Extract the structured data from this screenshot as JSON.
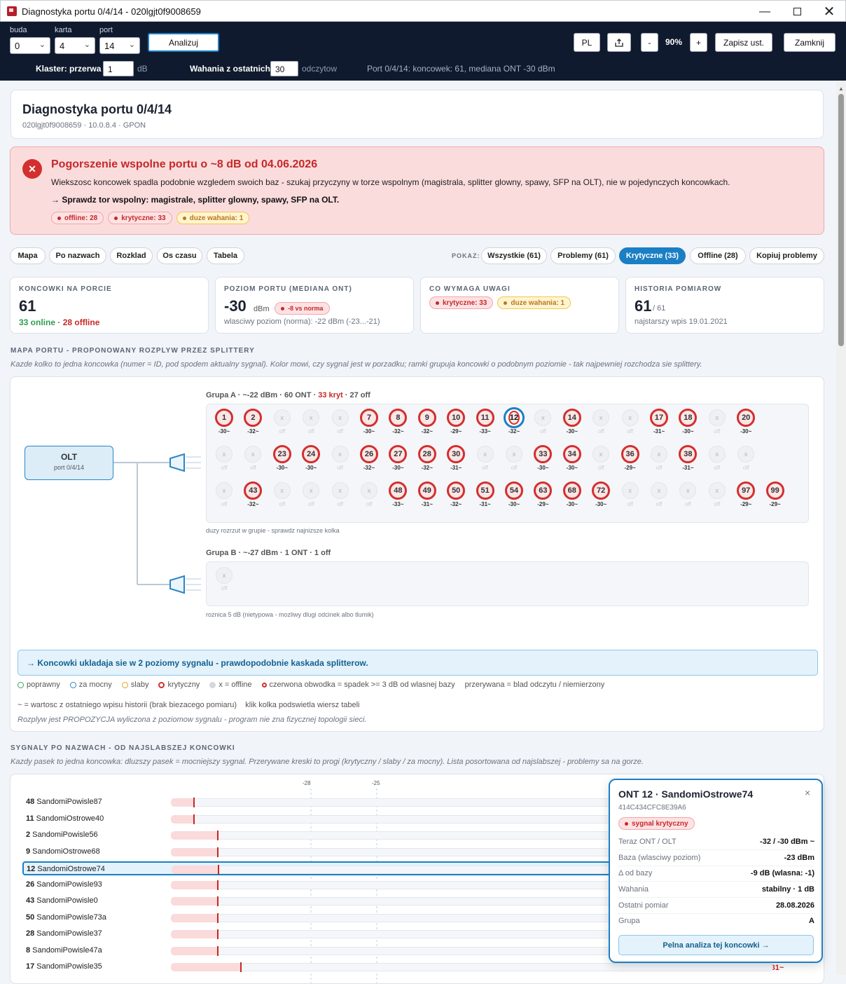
{
  "window": {
    "title": "Diagnostyka portu 0/4/14 - 020lgjt0f9008659"
  },
  "toolbar": {
    "buda_label": "buda",
    "buda_value": "0",
    "karta_label": "karta",
    "karta_value": "4",
    "port_label": "port",
    "port_value": "14",
    "analyze": "Analizuj",
    "lang": "PL",
    "zoom_minus": "-",
    "zoom": "90%",
    "zoom_plus": "+",
    "save": "Zapisz ust.",
    "close": "Zamknij",
    "cluster_label": "Klaster: przerwa",
    "cluster_value": "1",
    "cluster_unit": "dB",
    "waves_label": "Wahania z ostatnich",
    "waves_value": "30",
    "waves_unit": "odczytow",
    "summary": "Port 0/4/14: koncowek: 61, mediana ONT -30 dBm"
  },
  "header": {
    "title": "Diagnostyka portu 0/4/14",
    "subtitle": "020lgjt0f9008659 · 10.0.8.4 · GPON"
  },
  "alert": {
    "title": "Pogorszenie wspolne portu o ~8 dB od 04.06.2026",
    "body": "Wiekszosc koncowek spadla podobnie wzgledem swoich baz - szukaj przyczyny w torze wspolnym (magistrala, splitter glowny, spawy, SFP na OLT), nie w pojedynczych koncowkach.",
    "hint": "→ Sprawdz tor wspolny: magistrale, splitter glowny, spawy, SFP na OLT.",
    "badges": [
      "offline: 28",
      "krytyczne: 33",
      "duze wahania: 1"
    ]
  },
  "tabs": [
    "Mapa",
    "Po nazwach",
    "Rozklad",
    "Os czasu",
    "Tabela"
  ],
  "filter": {
    "label": "POKAZ:",
    "items": [
      "Wszystkie (61)",
      "Problemy (61)",
      "Krytyczne (33)",
      "Offline (28)",
      "Kopiuj problemy"
    ],
    "active": 2
  },
  "stats": [
    {
      "label": "KONCOWKI NA PORCIE",
      "value": "61",
      "online": "33 online",
      "sep": " · ",
      "offline": "28 offline"
    },
    {
      "label": "POZIOM PORTU (MEDIANA ONT)",
      "value": "-30",
      "unit": "dBm",
      "badge": "-8 vs norma",
      "sub": "wlasciwy poziom (norma): -22 dBm (-23...-21)"
    },
    {
      "label": "CO WYMAGA UWAGI",
      "badges": [
        "krytyczne: 33",
        "duze wahania: 1"
      ]
    },
    {
      "label": "HISTORIA POMIAROW",
      "value": "61",
      "of": "/ 61",
      "sub": "najstarszy wpis 19.01.2021"
    }
  ],
  "map": {
    "title": "MAPA PORTU - PROPONOWANY ROZPLYW PRZEZ SPLITTERY",
    "desc": "Kazde kolko to jedna koncowka (numer = ID, pod spodem aktualny sygnal). Kolor mowi, czy sygnal jest w porzadku; ramki grupuja koncowki o podobnym poziomie - tak najpewniej rozchodza sie splittery.",
    "olt_name": "OLT",
    "olt_port": "port 0/4/14",
    "groupA": {
      "head": "Grupa A · ~-22 dBm · 60 ONT · ",
      "crit": "33 kryt",
      "tail": " · 27 off",
      "note": "duzy rozrzut w grupie - sprawdz najnizsze kolka"
    },
    "groupB": {
      "head": "Grupa B · ~-27 dBm · 1 ONT · 1 off",
      "note": "roznica 5 dB (nietypowa - mozliwy dlugi odcinek albo tlumik)"
    },
    "off_symbol": "x",
    "off_label": "off",
    "rowsA": [
      [
        [
          "1",
          "-30~"
        ],
        [
          "2",
          "-32~"
        ],
        null,
        null,
        null,
        [
          "7",
          "-30~"
        ],
        [
          "8",
          "-32~"
        ],
        [
          "9",
          "-32~"
        ],
        [
          "10",
          "-29~"
        ],
        [
          "11",
          "-33~"
        ],
        [
          "12",
          "-32~"
        ],
        null,
        [
          "14",
          "-30~"
        ],
        null,
        null,
        [
          "17",
          "-31~"
        ],
        [
          "18",
          "-30~"
        ],
        null,
        [
          "20",
          "-30~"
        ]
      ],
      [
        null,
        null,
        [
          "23",
          "-30~"
        ],
        [
          "24",
          "-30~"
        ],
        null,
        [
          "26",
          "-32~"
        ],
        [
          "27",
          "-30~"
        ],
        [
          "28",
          "-32~"
        ],
        [
          "30",
          "-31~"
        ],
        null,
        null,
        [
          "33",
          "-30~"
        ],
        [
          "34",
          "-30~"
        ],
        null,
        [
          "36",
          "-29~"
        ],
        null,
        [
          "38",
          "-31~"
        ],
        null,
        null
      ],
      [
        null,
        [
          "43",
          "-32~"
        ],
        null,
        null,
        null,
        null,
        [
          "48",
          "-33~"
        ],
        [
          "49",
          "-31~"
        ],
        [
          "50",
          "-32~"
        ],
        [
          "51",
          "-31~"
        ],
        [
          "54",
          "-30~"
        ],
        [
          "63",
          "-29~"
        ],
        [
          "68",
          "-30~"
        ],
        [
          "72",
          "-30~"
        ],
        null,
        null,
        null,
        null,
        [
          "97",
          "-29~"
        ],
        [
          "99",
          "-29~"
        ]
      ]
    ],
    "selected_id": "12",
    "cascade_msg": "→  Koncowki ukladaja sie w 2 poziomy sygnalu - prawdopodobnie kaskada splitterow.",
    "legend": [
      "poprawny",
      "za mocny",
      "slaby",
      "krytyczny",
      "x = offline",
      "czerwona obwodka = spadek >= 3 dB od wlasnej bazy",
      "przerywana = blad odczytu / niemierzony"
    ],
    "legend2": "~ = wartosc z ostatniego wpisu historii (brak biezacego pomiaru)    klik kolka podswietla wiersz tabeli",
    "legend3": "Rozplyw jest PROPOZYCJA wyliczona z poziomow sygnalu - program nie zna fizycznej topologii sieci."
  },
  "signals": {
    "title": "SYGNALY PO NAZWACH - OD NAJSLABSZEJ KONCOWKI",
    "desc": "Kazdy pasek to jedna koncowka: dluzszy pasek = mocniejszy sygnal. Przerywane kreski to progi (krytyczny / slaby / za mocny). Lista posortowana od najslabszej - problemy sa na gorze.",
    "axis": [
      "-28",
      "-25"
    ],
    "rows": [
      {
        "id": "48",
        "name": "SandomiPowisle87",
        "dbm": -33
      },
      {
        "id": "11",
        "name": "SandomiOstrowe40",
        "dbm": -33
      },
      {
        "id": "2",
        "name": "SandomiPowisle56",
        "dbm": -32
      },
      {
        "id": "9",
        "name": "SandomiOstrowe68",
        "dbm": -32
      },
      {
        "id": "12",
        "name": "SandomiOstrowe74",
        "dbm": -32,
        "selected": true
      },
      {
        "id": "26",
        "name": "SandomiPowisle93",
        "dbm": -32
      },
      {
        "id": "43",
        "name": "SandomiPowisle0",
        "dbm": -32
      },
      {
        "id": "50",
        "name": "SandomiPowisle73a",
        "dbm": -32
      },
      {
        "id": "28",
        "name": "SandomiPowisle37",
        "dbm": -32
      },
      {
        "id": "8",
        "name": "SandomiPowisle47a",
        "dbm": -32
      },
      {
        "id": "17",
        "name": "SandomiPowisle35",
        "dbm": -31,
        "value_label": "-31~"
      }
    ]
  },
  "popup": {
    "title": "ONT 12 · SandomiOstrowe74",
    "serial": "414C434CFC8E39A6",
    "badge": "sygnal krytyczny",
    "rows": [
      {
        "k": "Teraz ONT / OLT",
        "v": "-32 / -30 dBm ~"
      },
      {
        "k": "Baza (wlasciwy poziom)",
        "v": "-23 dBm"
      },
      {
        "k": "Δ od bazy",
        "v": "-9 dB (wlasna: -1)"
      },
      {
        "k": "Wahania",
        "v": "stabilny · 1 dB"
      },
      {
        "k": "Ostatni pomiar",
        "v": "28.08.2026"
      },
      {
        "k": "Grupa",
        "v": "A"
      }
    ],
    "action": "Pelna analiza tej koncowki →",
    "close": "×"
  }
}
